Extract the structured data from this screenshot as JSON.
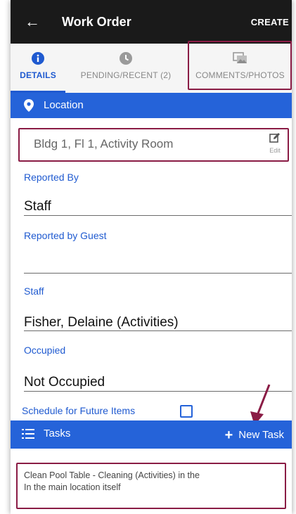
{
  "appbar": {
    "back_glyph": "←",
    "title": "Work Order",
    "create_label": "CREATE"
  },
  "tabs": [
    {
      "label": "DETAILS",
      "icon": "info-icon",
      "active": true
    },
    {
      "label": "PENDING/RECENT (2)",
      "icon": "clock-icon",
      "active": false
    },
    {
      "label": "COMMENTS/PHOTOS",
      "icon": "photos-icon",
      "active": false
    }
  ],
  "location": {
    "section_label": "Location",
    "value": "Bldg 1, Fl 1, Activity Room",
    "edit_label": "Edit"
  },
  "fields": {
    "reported_by": {
      "label": "Reported By",
      "value": "Staff"
    },
    "reported_by_guest": {
      "label": "Reported by Guest",
      "value": ""
    },
    "staff": {
      "label": "Staff",
      "value": "Fisher, Delaine (Activities)"
    },
    "occupied": {
      "label": "Occupied",
      "value": "Not Occupied"
    }
  },
  "schedule": {
    "label": "Schedule for Future Items",
    "checked": false
  },
  "tasks": {
    "section_label": "Tasks",
    "new_task_label": "New Task",
    "items": [
      {
        "line1": "Clean Pool Table - Cleaning (Activities) in the",
        "line2": "In the main location itself"
      }
    ]
  },
  "colors": {
    "accent": "#2563d9",
    "appbar": "#1a1a1a",
    "highlight": "#8a1c45"
  }
}
